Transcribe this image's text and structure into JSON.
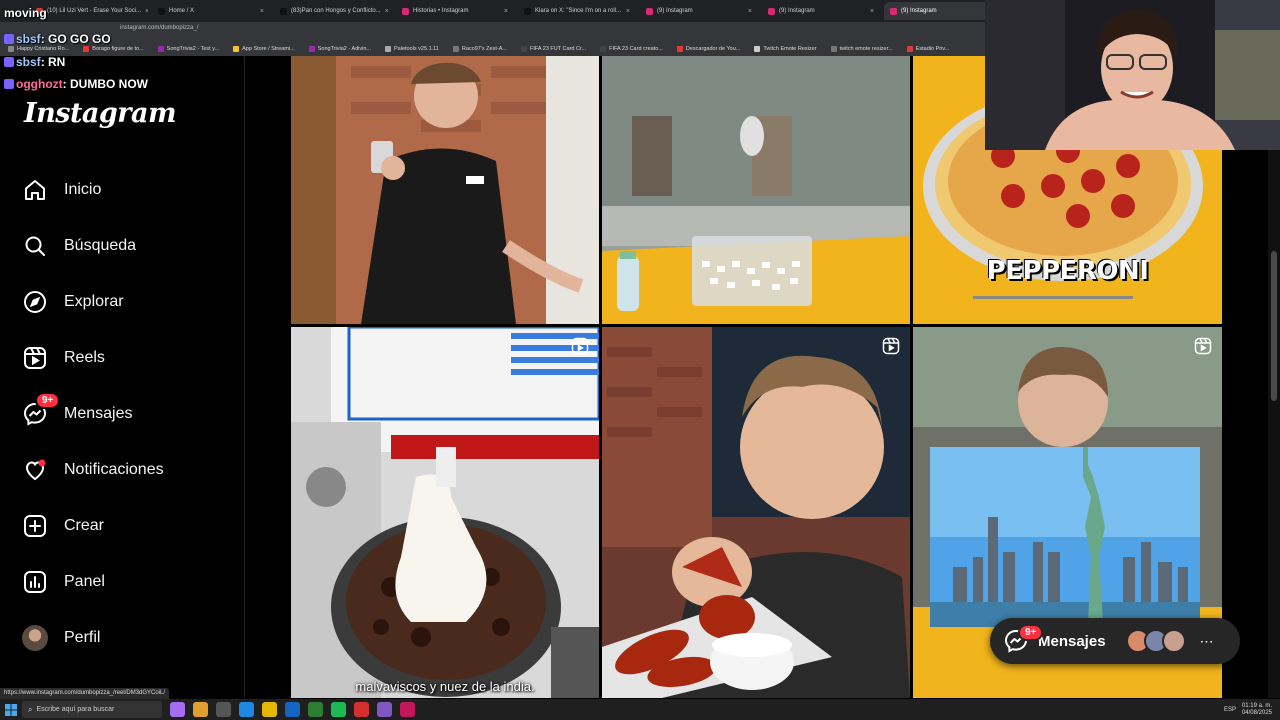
{
  "browser": {
    "tabs": [
      {
        "label": "(10) Lil Uzi Vert - Erase Your Soci...",
        "color": "#e53935",
        "active": false
      },
      {
        "label": "Home / X",
        "color": "#111111",
        "active": false
      },
      {
        "label": "(83)Pan con Hongos y Conflicto...",
        "color": "#111111",
        "active": false
      },
      {
        "label": "Historias • Instagram",
        "color": "#d62976",
        "active": false
      },
      {
        "label": "Klara on X: \"Since I'm on a roll...",
        "color": "#111111",
        "active": false
      },
      {
        "label": "(9) Instagram",
        "color": "#d62976",
        "active": false
      },
      {
        "label": "(9) Instagram",
        "color": "#d62976",
        "active": false
      },
      {
        "label": "(9) Instagram",
        "color": "#d62976",
        "active": true
      }
    ],
    "url": "instagram.com/dumbopizza_/",
    "bookmarks": [
      {
        "label": "Happy Cristiano Ro...",
        "color": "#888888"
      },
      {
        "label": "Borago figure de to...",
        "color": "#e53935"
      },
      {
        "label": "SongTrivia2 - Test y...",
        "color": "#9c27b0"
      },
      {
        "label": "App Store / Streami...",
        "color": "#fbc02d"
      },
      {
        "label": "SongTrivia2 - Adivin...",
        "color": "#9c27b0"
      },
      {
        "label": "Paletools v25.1.11",
        "color": "#aaaaaa"
      },
      {
        "label": "Raco97's Zest-A...",
        "color": "#777777"
      },
      {
        "label": "FIFA 23 FUT Card Cr...",
        "color": "#444444"
      },
      {
        "label": "FIFA 23 Card creato...",
        "color": "#444444"
      },
      {
        "label": "Descargador de You...",
        "color": "#e53935"
      },
      {
        "label": "Twitch Emote Resizer",
        "color": "#cccccc"
      },
      {
        "label": "twitch emote resizer...",
        "color": "#777777"
      },
      {
        "label": "Estadio Priv...",
        "color": "#e53935"
      }
    ],
    "status_url": "https://www.instagram.com/dumbopizza_/reel/DM3dGYCoiL/"
  },
  "chat": {
    "top_text": "moving",
    "lines": [
      {
        "user": "sbsf",
        "message": ": GO GO GO",
        "pink": false
      },
      {
        "user": "sbsf",
        "message": ": RN",
        "pink": false
      },
      {
        "user": "ogghozt",
        "message": ": DUMBO NOW",
        "pink": true
      }
    ]
  },
  "sidebar": {
    "logo": "Instagram",
    "items": [
      {
        "label": "Inicio",
        "icon": "home-icon"
      },
      {
        "label": "Búsqueda",
        "icon": "search-icon"
      },
      {
        "label": "Explorar",
        "icon": "compass-icon"
      },
      {
        "label": "Reels",
        "icon": "reels-icon"
      },
      {
        "label": "Mensajes",
        "icon": "messenger-icon",
        "badge": "9+"
      },
      {
        "label": "Notificaciones",
        "icon": "heart-icon"
      },
      {
        "label": "Crear",
        "icon": "create-icon"
      },
      {
        "label": "Panel",
        "icon": "dashboard-icon"
      },
      {
        "label": "Perfil",
        "icon": "avatar-icon"
      }
    ]
  },
  "posts": {
    "pepperoni_caption": "PEPPERONI",
    "subtitle": "malvaviscos y nuez de la india."
  },
  "messages_pill": {
    "label": "Mensajes",
    "badge": "9+"
  },
  "taskbar": {
    "search_placeholder": "Escribe aquí para buscar",
    "language": "ESP",
    "time": "01:19 a. m.",
    "date": "04/08/2025"
  },
  "colors": {
    "accent_red": "#ff3040",
    "bg": "#000000",
    "divider": "#262626"
  }
}
